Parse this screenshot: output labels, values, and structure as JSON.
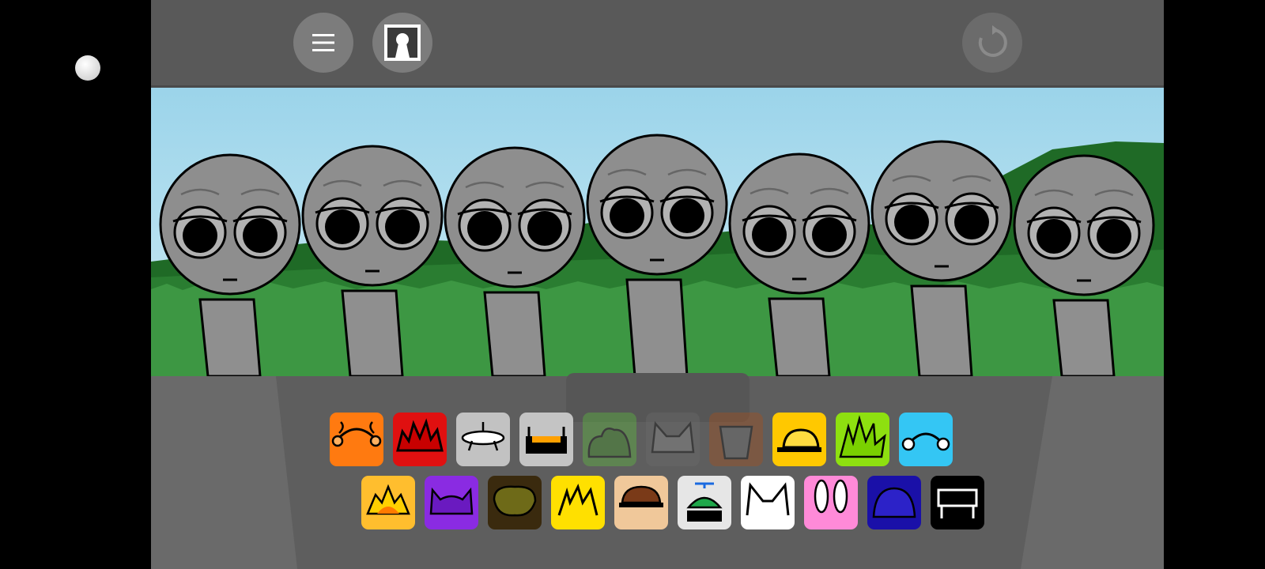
{
  "app": {
    "scene": "grassland",
    "toolbar": {
      "menu_icon": "hamburger-menu-icon",
      "portrait_icon": "portrait-keyhole-icon",
      "reset_icon": "refresh-icon",
      "reset_enabled": false
    }
  },
  "characters": [
    {
      "index": 1,
      "state": "idle",
      "eyes": "sleepy"
    },
    {
      "index": 2,
      "state": "idle",
      "eyes": "sleepy"
    },
    {
      "index": 3,
      "state": "idle",
      "eyes": "sleepy"
    },
    {
      "index": 4,
      "state": "idle",
      "eyes": "sleepy"
    },
    {
      "index": 5,
      "state": "idle",
      "eyes": "sleepy"
    },
    {
      "index": 6,
      "state": "idle",
      "eyes": "sleepy"
    },
    {
      "index": 7,
      "state": "idle",
      "eyes": "sleepy"
    }
  ],
  "sound_palette": {
    "row1": [
      {
        "name": "orange-beat",
        "color": "#ff7a10",
        "available": true
      },
      {
        "name": "red-spikes",
        "color": "#e01010",
        "available": true
      },
      {
        "name": "grey-saucer",
        "color": "#c2c2c2",
        "available": true
      },
      {
        "name": "grey-headphones",
        "color": "#c4c4c4",
        "available": true
      },
      {
        "name": "green-bush",
        "color": "#5ecb3a",
        "available": false
      },
      {
        "name": "grey-cat",
        "color": "#6e6e6e",
        "available": false
      },
      {
        "name": "brown-bucket",
        "color": "#b34e14",
        "available": false
      },
      {
        "name": "yellow-cap",
        "color": "#ffc800",
        "available": true
      },
      {
        "name": "lime-spikes",
        "color": "#8ee010",
        "available": true
      },
      {
        "name": "cyan-headset",
        "color": "#34c6f4",
        "available": true
      }
    ],
    "row2": [
      {
        "name": "sun-burst",
        "color": "#ffbe2e",
        "available": true
      },
      {
        "name": "purple-horns",
        "color": "#8a2be2",
        "available": true
      },
      {
        "name": "olive-blob",
        "color": "#3a2a0e",
        "available": true
      },
      {
        "name": "yellow-sparks",
        "color": "#ffe000",
        "available": true
      },
      {
        "name": "brown-hair",
        "color": "#f0c89a",
        "available": true
      },
      {
        "name": "propeller-cap",
        "color": "#e6e6e6",
        "available": true
      },
      {
        "name": "white-cat",
        "color": "#ffffff",
        "available": true
      },
      {
        "name": "pink-bunny",
        "color": "#ff8ad8",
        "available": true
      },
      {
        "name": "navy-dome",
        "color": "#1a10a8",
        "available": true
      },
      {
        "name": "black-bench",
        "color": "#000000",
        "available": true
      }
    ]
  }
}
